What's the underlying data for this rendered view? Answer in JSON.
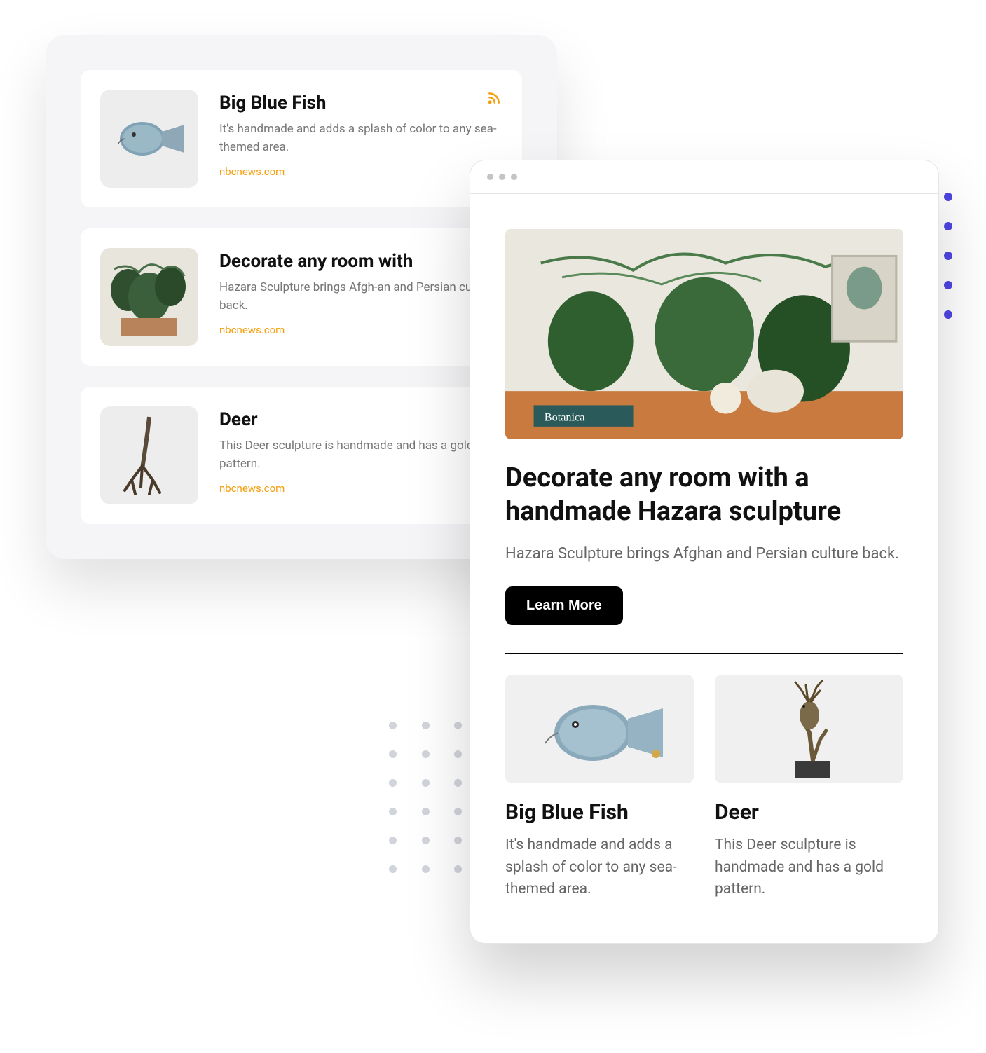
{
  "list": [
    {
      "title": "Big Blue Fish",
      "desc": "It's handmade and adds a splash of color to any sea-themed area.",
      "source": "nbcnews.com",
      "rss": true
    },
    {
      "title": "Decorate any room with",
      "desc": "Hazara Sculpture brings Afgh-an and Persian culture back.",
      "source": "nbcnews.com",
      "rss": false
    },
    {
      "title": "Deer",
      "desc": "This Deer sculpture is handmade and has a gold pattern.",
      "source": "nbcnews.com",
      "rss": false
    }
  ],
  "hero": {
    "title": "Decorate any room with a handmade Hazara sculpture",
    "desc": "Hazara Sculpture brings Afghan and Persian culture back.",
    "button": "Learn More"
  },
  "grid": [
    {
      "title": "Big Blue Fish",
      "desc": "It's handmade and adds a splash of color to any sea-themed area."
    },
    {
      "title": "Deer",
      "desc": "This Deer sculpture is handmade and has a gold pattern."
    }
  ]
}
